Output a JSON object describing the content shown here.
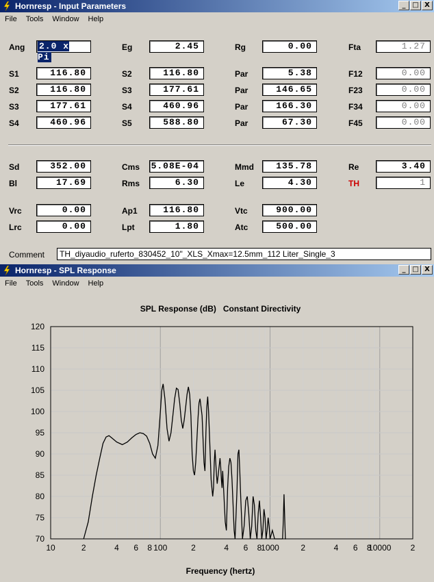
{
  "window1": {
    "title": "Hornresp - Input Parameters",
    "menu": [
      "File",
      "Tools",
      "Window",
      "Help"
    ],
    "controls": [
      "_",
      "□",
      "X"
    ]
  },
  "params": {
    "Ang": "2.0 x Pi",
    "Eg": "2.45",
    "Rg": "0.00",
    "Fta": "1.27",
    "S1": "116.80",
    "S2a": "116.80",
    "Par1": "5.38",
    "F12": "0.00",
    "S2": "116.80",
    "S3a": "177.61",
    "Par2": "146.65",
    "F23": "0.00",
    "S3": "177.61",
    "S4a": "460.96",
    "Par3": "166.30",
    "F34": "0.00",
    "S4": "460.96",
    "S5": "588.80",
    "Par4": "67.30",
    "F45": "0.00",
    "Sd": "352.00",
    "Cms": "5.08E-04",
    "Mmd": "135.78",
    "Re": "3.40",
    "Bl": "17.69",
    "Rms": "6.30",
    "Le": "4.30",
    "TH": "1",
    "Vrc": "0.00",
    "Ap1": "116.80",
    "Vtc": "900.00",
    "Lrc": "0.00",
    "Lpt": "1.80",
    "Atc": "500.00"
  },
  "labels": {
    "Ang": "Ang",
    "Eg": "Eg",
    "Rg": "Rg",
    "Fta": "Fta",
    "S1": "S1",
    "S2": "S2",
    "S3": "S3",
    "S4": "S4",
    "S5": "S5",
    "Par": "Par",
    "F12": "F12",
    "F23": "F23",
    "F34": "F34",
    "F45": "F45",
    "Sd": "Sd",
    "Cms": "Cms",
    "Mmd": "Mmd",
    "Re": "Re",
    "Bl": "Bl",
    "Rms": "Rms",
    "Le": "Le",
    "TH": "TH",
    "Vrc": "Vrc",
    "Ap1": "Ap1",
    "Vtc": "Vtc",
    "Lrc": "Lrc",
    "Lpt": "Lpt",
    "Atc": "Atc",
    "Comment": "Comment"
  },
  "comment": "TH_diyaudio_ruferto_830452_10\"_XLS_Xmax=12.5mm_112 Liter_Single_3",
  "window2": {
    "title": "Hornresp - SPL Response",
    "menu": [
      "File",
      "Tools",
      "Window",
      "Help"
    ],
    "controls": [
      "_",
      "□",
      "X"
    ]
  },
  "chart_data": {
    "type": "line",
    "title": "SPL Response (dB)   Constant Directivity",
    "xlabel": "Frequency (hertz)",
    "ylabel": "",
    "xscale": "log",
    "xlim": [
      10,
      20000
    ],
    "ylim": [
      70,
      120
    ],
    "yticks": [
      70,
      75,
      80,
      85,
      90,
      95,
      100,
      105,
      110,
      115,
      120
    ],
    "xtick_labels": [
      {
        "v": 10,
        "t": "10"
      },
      {
        "v": 20,
        "t": "2"
      },
      {
        "v": 40,
        "t": "4"
      },
      {
        "v": 60,
        "t": "6"
      },
      {
        "v": 80,
        "t": "8"
      },
      {
        "v": 100,
        "t": "100"
      },
      {
        "v": 200,
        "t": "2"
      },
      {
        "v": 400,
        "t": "4"
      },
      {
        "v": 600,
        "t": "6"
      },
      {
        "v": 800,
        "t": "8"
      },
      {
        "v": 1000,
        "t": "1000"
      },
      {
        "v": 2000,
        "t": "2"
      },
      {
        "v": 4000,
        "t": "4"
      },
      {
        "v": 6000,
        "t": "6"
      },
      {
        "v": 8000,
        "t": "8"
      },
      {
        "v": 10000,
        "t": "10000"
      },
      {
        "v": 20000,
        "t": "2"
      }
    ],
    "grid": true,
    "series": [
      {
        "color": "#000000",
        "x": [
          20,
          22,
          24,
          26,
          28,
          30,
          32,
          34,
          36,
          40,
          45,
          50,
          55,
          60,
          65,
          70,
          75,
          80,
          85,
          90,
          95,
          100,
          103,
          106,
          110,
          115,
          120,
          125,
          130,
          135,
          140,
          145,
          150,
          155,
          160,
          165,
          170,
          175,
          180,
          185,
          190,
          195,
          200,
          205,
          210,
          215,
          220,
          225,
          230,
          240,
          250,
          255,
          260,
          265,
          270,
          275,
          280,
          290,
          300,
          305,
          310,
          315,
          320,
          325,
          330,
          340,
          350,
          355,
          360,
          365,
          370,
          380,
          390,
          400,
          410,
          420,
          430,
          440,
          450,
          460,
          470,
          480,
          490,
          500,
          510,
          520,
          530,
          540,
          560,
          580,
          600,
          620,
          640,
          660,
          680,
          700,
          720,
          740,
          760,
          780,
          800,
          820,
          840,
          860,
          880,
          900,
          920,
          940,
          960,
          980,
          1000,
          1050,
          1100,
          1150,
          1200,
          1250,
          1300,
          1320,
          1340,
          1360,
          1380,
          1400
        ],
        "y": [
          70,
          74,
          80,
          85,
          89,
          92.5,
          94,
          94.3,
          93.8,
          92.8,
          92.2,
          92.8,
          93.8,
          94.6,
          95,
          94.8,
          94.2,
          92.5,
          90,
          89,
          92,
          100,
          105,
          106.5,
          103,
          96,
          93,
          95,
          99,
          103,
          105.5,
          105.2,
          102,
          98,
          96,
          98,
          101,
          104,
          105.8,
          104,
          99,
          90,
          86,
          85,
          88,
          93,
          98,
          102,
          103,
          99,
          88,
          86,
          95,
          101,
          103.5,
          100,
          95,
          84,
          80,
          82,
          88,
          91,
          88,
          85,
          83,
          86,
          89,
          87,
          84,
          82,
          86,
          80,
          74,
          72,
          82,
          87,
          89,
          88,
          84,
          78,
          72,
          70,
          76,
          82,
          90,
          91,
          86,
          80,
          70,
          73,
          79,
          80,
          76,
          70,
          73,
          80,
          78,
          72,
          70,
          76,
          79,
          75,
          70,
          72,
          77,
          75,
          70,
          72,
          75,
          73,
          70,
          72,
          70,
          70,
          70,
          70,
          70,
          74,
          80.5,
          75,
          70,
          70
        ]
      }
    ]
  }
}
